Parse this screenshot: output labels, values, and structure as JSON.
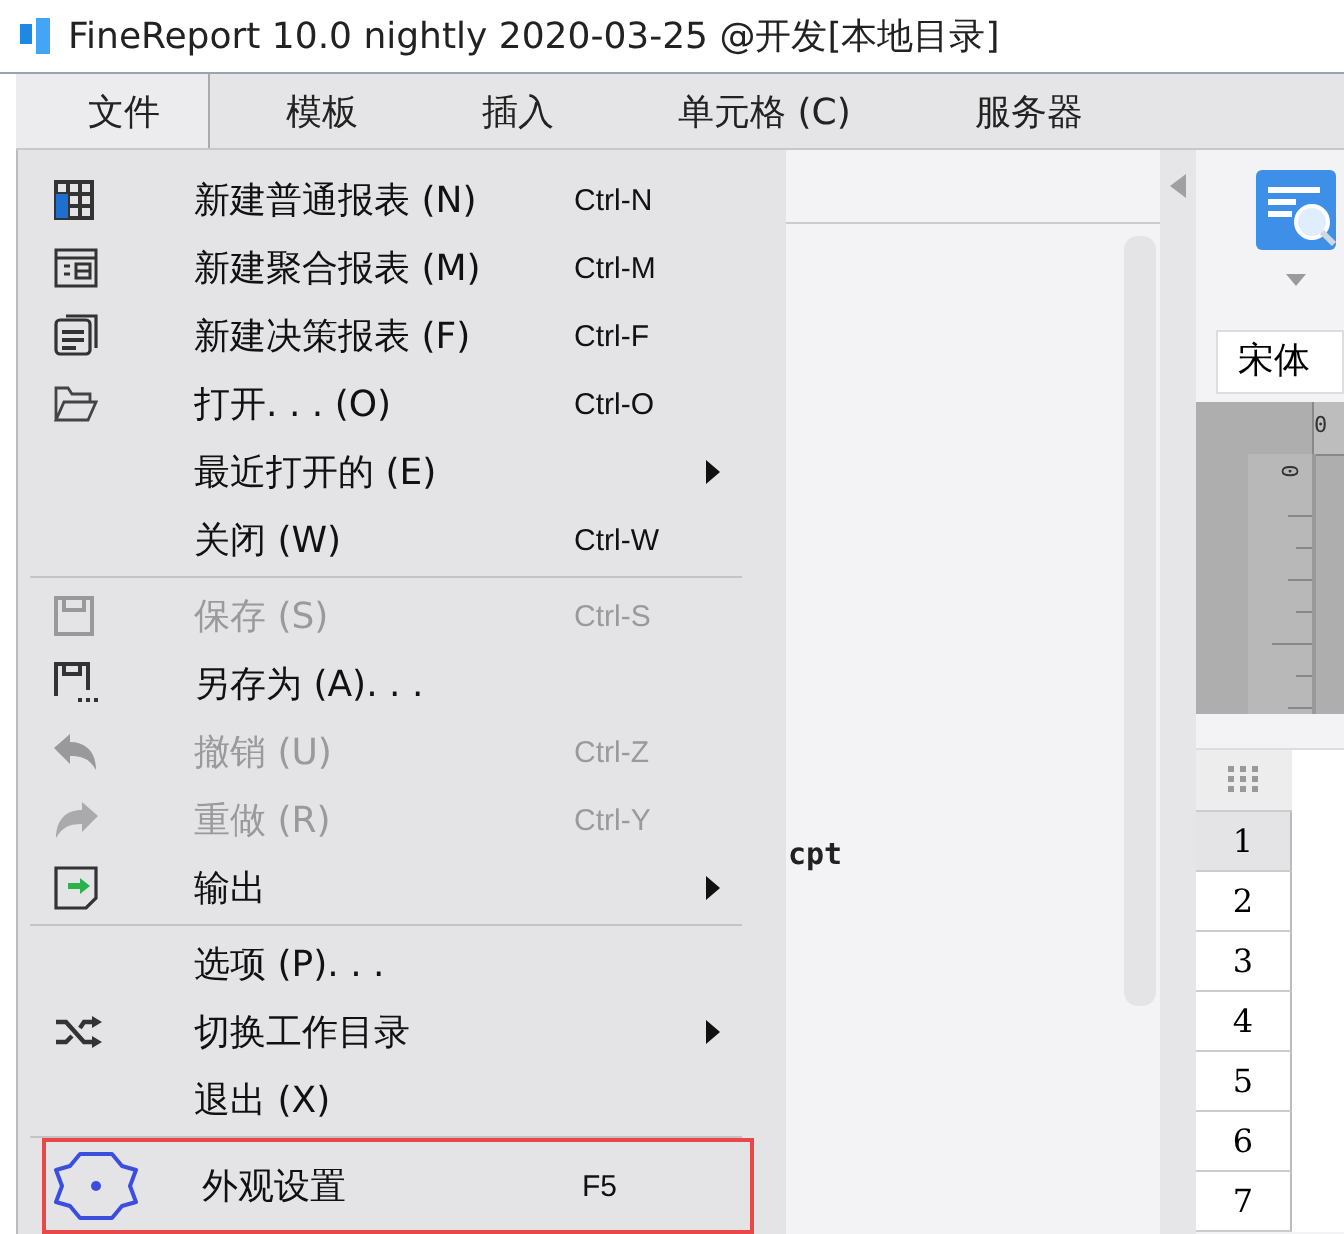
{
  "window": {
    "title": "FineReport 10.0 nightly 2020-03-25 @开发[本地目录]"
  },
  "menubar": [
    {
      "label": "文件",
      "selected": true
    },
    {
      "label": "模板",
      "selected": false
    },
    {
      "label": "插入",
      "selected": false
    },
    {
      "label": "单元格 (C)",
      "selected": false
    },
    {
      "label": "服务器",
      "selected": false
    }
  ],
  "file_menu": [
    {
      "kind": "item",
      "label": "新建普通报表 (N)",
      "shortcut": "Ctrl-N",
      "disabled": false,
      "submenu": false,
      "highlighted": false
    },
    {
      "kind": "item",
      "label": "新建聚合报表 (M)",
      "shortcut": "Ctrl-M",
      "disabled": false,
      "submenu": false,
      "highlighted": false
    },
    {
      "kind": "item",
      "label": "新建决策报表 (F)",
      "shortcut": "Ctrl-F",
      "disabled": false,
      "submenu": false,
      "highlighted": false
    },
    {
      "kind": "item",
      "label": "打开. . . (O)",
      "shortcut": "Ctrl-O",
      "disabled": false,
      "submenu": false,
      "highlighted": false
    },
    {
      "kind": "item",
      "label": "最近打开的 (E)",
      "disabled": false,
      "submenu": true,
      "highlighted": false
    },
    {
      "kind": "item",
      "label": "关闭 (W)",
      "shortcut": "Ctrl-W",
      "disabled": false,
      "submenu": false,
      "highlighted": false
    },
    {
      "kind": "separator"
    },
    {
      "kind": "item",
      "label": "保存 (S)",
      "shortcut": "Ctrl-S",
      "disabled": true,
      "submenu": false,
      "highlighted": false
    },
    {
      "kind": "item",
      "label": "另存为 (A). . .",
      "disabled": false,
      "submenu": false,
      "highlighted": false
    },
    {
      "kind": "item",
      "label": "撤销 (U)",
      "shortcut": "Ctrl-Z",
      "disabled": true,
      "submenu": false,
      "highlighted": false
    },
    {
      "kind": "item",
      "label": "重做 (R)",
      "shortcut": "Ctrl-Y",
      "disabled": true,
      "submenu": false,
      "highlighted": false
    },
    {
      "kind": "item",
      "label": "输出",
      "disabled": false,
      "submenu": true,
      "highlighted": false
    },
    {
      "kind": "separator"
    },
    {
      "kind": "item",
      "label": "选项 (P). . .",
      "disabled": false,
      "submenu": false,
      "highlighted": false
    },
    {
      "kind": "item",
      "label": "切换工作目录",
      "disabled": false,
      "submenu": true,
      "highlighted": false
    },
    {
      "kind": "item",
      "label": "退出 (X)",
      "disabled": false,
      "submenu": false,
      "highlighted": false
    },
    {
      "kind": "separator"
    },
    {
      "kind": "item",
      "label": "外观设置",
      "shortcut": "F5",
      "disabled": false,
      "submenu": false,
      "highlighted": true
    }
  ],
  "document": {
    "text": "cpt"
  },
  "right_panel": {
    "font_field": "宋体",
    "ruler_labels": [
      "0",
      "0"
    ],
    "row_headers": [
      "1",
      "2",
      "3",
      "4",
      "5",
      "6",
      "7"
    ]
  }
}
